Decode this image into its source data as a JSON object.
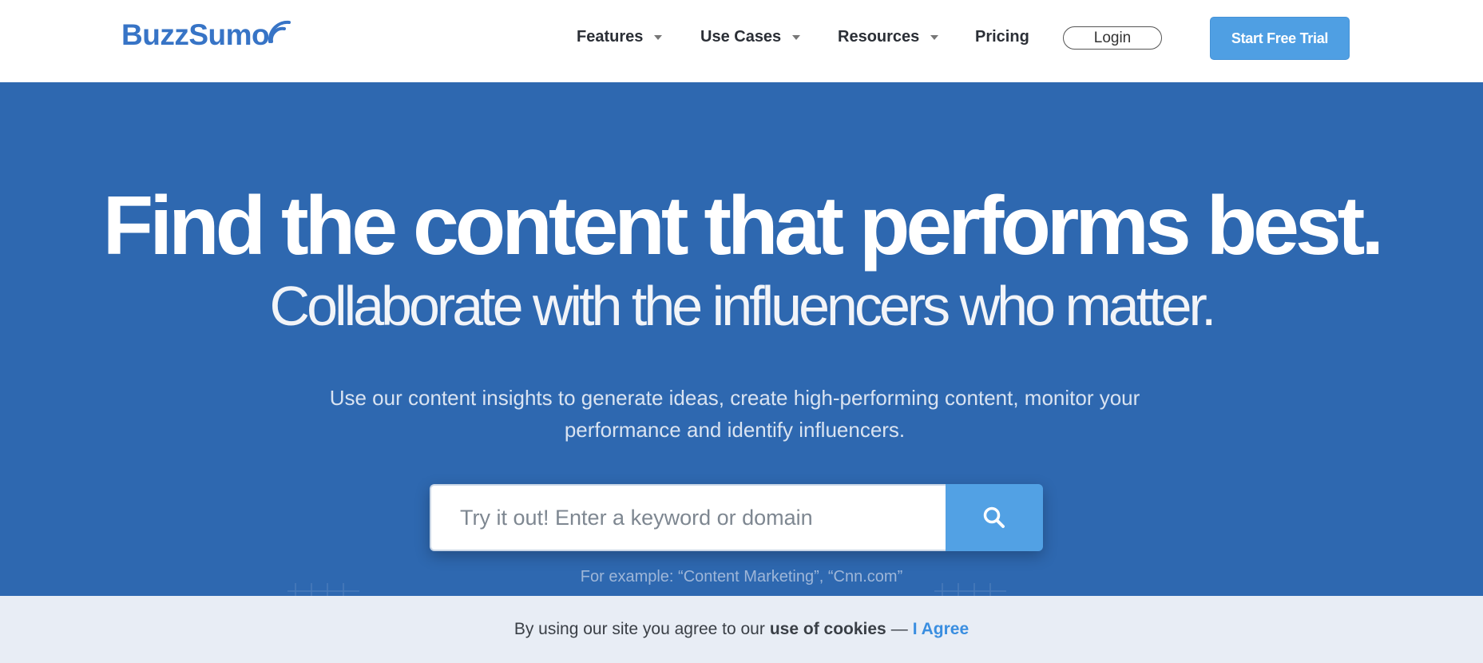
{
  "brand": {
    "name": "BuzzSumo",
    "color": "#3774c6"
  },
  "nav": {
    "features": "Features",
    "use_cases": "Use Cases",
    "resources": "Resources",
    "pricing": "Pricing",
    "login": "Login",
    "start_trial": "Start Free Trial"
  },
  "hero": {
    "headline": "Find the content that performs best.",
    "subheadline": "Collaborate with the influencers who matter.",
    "description": "Use our content insights to generate ideas, create high-performing content, monitor your performance and identify influencers.",
    "search_placeholder": "Try it out! Enter a keyword or domain",
    "search_icon": "search-icon",
    "example": "For example: “Content Marketing”, “Cnn.com”"
  },
  "cookie": {
    "text": "By using our site you agree to our",
    "link": "use of cookies",
    "dash": "—",
    "agree": "I Agree"
  },
  "colors": {
    "hero_bg": "#2e68b0",
    "accent": "#4f9fe3",
    "cookie_bg": "#e8edf5"
  }
}
